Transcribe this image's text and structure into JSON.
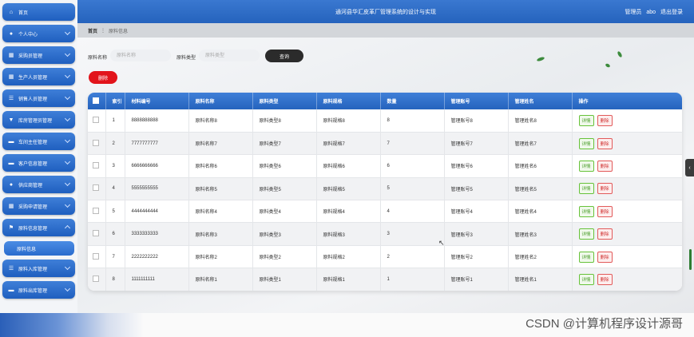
{
  "sidebar": {
    "items": [
      {
        "label": "首页",
        "icon": "home-icon",
        "glyph": "⌂",
        "has_children": false
      },
      {
        "label": "个人中心",
        "icon": "user-icon",
        "glyph": "●",
        "has_children": true
      },
      {
        "label": "采购员管理",
        "icon": "grid-icon",
        "glyph": "▦",
        "has_children": true
      },
      {
        "label": "生产人员管理",
        "icon": "grid-icon",
        "glyph": "▦",
        "has_children": true
      },
      {
        "label": "销售人员管理",
        "icon": "list-icon",
        "glyph": "☰",
        "has_children": true
      },
      {
        "label": "库房管理员管理",
        "icon": "shield-icon",
        "glyph": "▼",
        "has_children": true
      },
      {
        "label": "车间主任管理",
        "icon": "truck-icon",
        "glyph": "▬",
        "has_children": true
      },
      {
        "label": "客户信息管理",
        "icon": "card-icon",
        "glyph": "▬",
        "has_children": true
      },
      {
        "label": "供应商管理",
        "icon": "user-icon",
        "glyph": "●",
        "has_children": true
      },
      {
        "label": "采购申请管理",
        "icon": "grid-icon",
        "glyph": "▦",
        "has_children": true
      },
      {
        "label": "原料信息管理",
        "icon": "flag-icon",
        "glyph": "⚑",
        "has_children": true,
        "open": true
      },
      {
        "label": "原料入库管理",
        "icon": "list-icon",
        "glyph": "☰",
        "has_children": true
      },
      {
        "label": "原料出库管理",
        "icon": "card-icon",
        "glyph": "▬",
        "has_children": true
      }
    ],
    "active_sub": "原料信息"
  },
  "header": {
    "title": "通河县华汇皮革厂管理系统的设计与实现",
    "role": "管理员",
    "username": "abo",
    "logout": "退出登录"
  },
  "breadcrumb": {
    "home": "首页",
    "separator": "⋮",
    "current": "原料信息"
  },
  "search": {
    "name_label": "原料名称",
    "name_placeholder": "原料名称",
    "type_label": "原料类型",
    "type_placeholder": "原料类型",
    "button": "查询"
  },
  "actions": {
    "delete": "删除"
  },
  "table": {
    "columns": [
      "",
      "索引",
      "材料编号",
      "原料名称",
      "原料类型",
      "原料规格",
      "数量",
      "管理账号",
      "管理姓名",
      "操作"
    ],
    "detail_label": "详情",
    "delete_label": "删除",
    "rows": [
      {
        "index": "1",
        "code": "8888888888",
        "name": "原料名称8",
        "type": "原料类型8",
        "spec": "原料规格8",
        "qty": "8",
        "account": "管理账号8",
        "manager": "管理姓名8"
      },
      {
        "index": "2",
        "code": "7777777777",
        "name": "原料名称7",
        "type": "原料类型7",
        "spec": "原料规格7",
        "qty": "7",
        "account": "管理账号7",
        "manager": "管理姓名7"
      },
      {
        "index": "3",
        "code": "6666666666",
        "name": "原料名称6",
        "type": "原料类型6",
        "spec": "原料规格6",
        "qty": "6",
        "account": "管理账号6",
        "manager": "管理姓名6"
      },
      {
        "index": "4",
        "code": "5555555555",
        "name": "原料名称5",
        "type": "原料类型5",
        "spec": "原料规格5",
        "qty": "5",
        "account": "管理账号5",
        "manager": "管理姓名5"
      },
      {
        "index": "5",
        "code": "4444444444",
        "name": "原料名称4",
        "type": "原料类型4",
        "spec": "原料规格4",
        "qty": "4",
        "account": "管理账号4",
        "manager": "管理姓名4"
      },
      {
        "index": "6",
        "code": "3333333333",
        "name": "原料名称3",
        "type": "原料类型3",
        "spec": "原料规格3",
        "qty": "3",
        "account": "管理账号3",
        "manager": "管理姓名3"
      },
      {
        "index": "7",
        "code": "2222222222",
        "name": "原料名称2",
        "type": "原料类型2",
        "spec": "原料规格2",
        "qty": "2",
        "account": "管理账号2",
        "manager": "管理姓名2"
      },
      {
        "index": "8",
        "code": "1111111111",
        "name": "原料名称1",
        "type": "原料类型1",
        "spec": "原料规格1",
        "qty": "1",
        "account": "管理账号1",
        "manager": "管理姓名1"
      }
    ]
  },
  "watermark": "CSDN @计算机程序设计源哥",
  "colors": {
    "primary": "#2563bd",
    "danger": "#e2141b",
    "dark_button": "#2b2b2b",
    "detail_green": "#67c23a"
  }
}
